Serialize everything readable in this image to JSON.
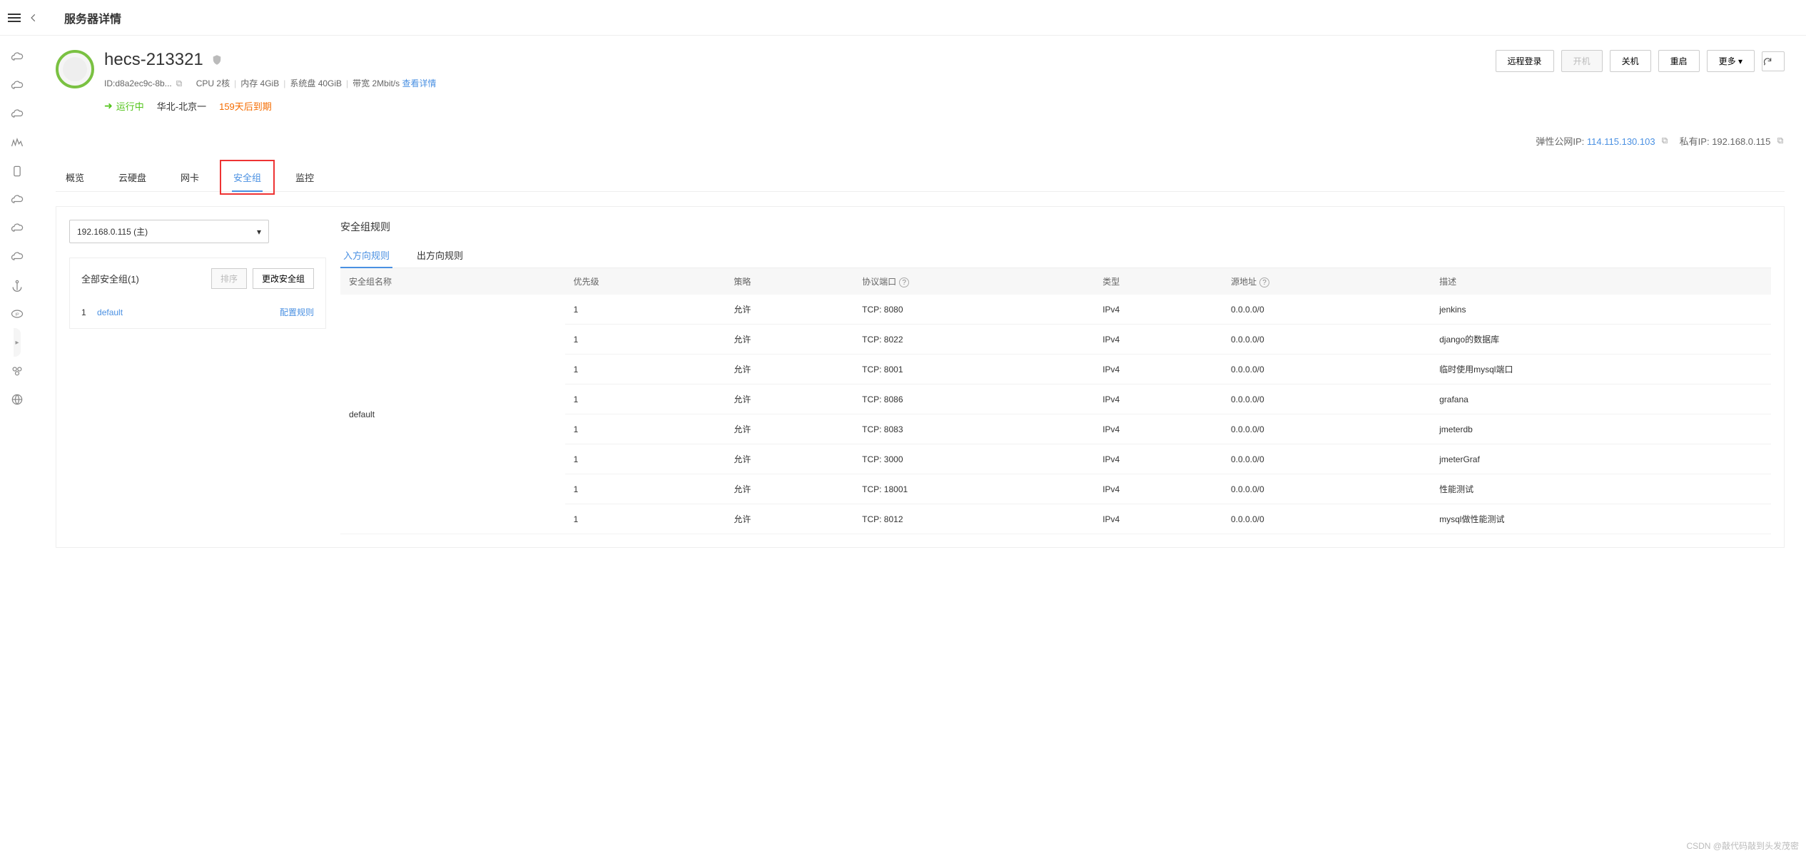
{
  "page": {
    "title": "服务器详情"
  },
  "server": {
    "name": "hecs-213321",
    "id_label": "ID:",
    "id_value": "d8a2ec9c-8b...",
    "spec_cpu": "CPU 2核",
    "spec_mem": "内存 4GiB",
    "spec_disk": "系统盘 40GiB",
    "spec_bw": "带宽 2Mbit/s",
    "spec_link": "查看详情",
    "status": "运行中",
    "region": "华北-北京一",
    "expire": "159天后到期",
    "eip_label": "弹性公网IP:",
    "eip_value": "114.115.130.103",
    "pip_label": "私有IP:",
    "pip_value": "192.168.0.115"
  },
  "actions": {
    "remote_login": "远程登录",
    "power_on": "开机",
    "power_off": "关机",
    "restart": "重启",
    "more": "更多"
  },
  "tabs": {
    "overview": "概览",
    "disk": "云硬盘",
    "nic": "网卡",
    "security_group": "安全组",
    "monitoring": "监控"
  },
  "sg_left": {
    "nic_select_value": "192.168.0.115 (主)",
    "all_sg_label": "全部安全组(1)",
    "sort_btn": "排序",
    "change_btn": "更改安全组",
    "items": [
      {
        "idx": "1",
        "name": "default",
        "config": "配置规则"
      }
    ]
  },
  "rules": {
    "title": "安全组规则",
    "sub_tabs": {
      "inbound": "入方向规则",
      "outbound": "出方向规则"
    },
    "columns": {
      "sg_name": "安全组名称",
      "priority": "优先级",
      "policy": "策略",
      "protocol_port": "协议端口",
      "type": "类型",
      "source": "源地址",
      "description": "描述"
    },
    "group_name": "default",
    "rows": [
      {
        "priority": "1",
        "policy": "允许",
        "protocol": "TCP: 8080",
        "type": "IPv4",
        "source": "0.0.0.0/0",
        "desc": "jenkins"
      },
      {
        "priority": "1",
        "policy": "允许",
        "protocol": "TCP: 8022",
        "type": "IPv4",
        "source": "0.0.0.0/0",
        "desc": "django的数据库"
      },
      {
        "priority": "1",
        "policy": "允许",
        "protocol": "TCP: 8001",
        "type": "IPv4",
        "source": "0.0.0.0/0",
        "desc": "临时使用mysql端口"
      },
      {
        "priority": "1",
        "policy": "允许",
        "protocol": "TCP: 8086",
        "type": "IPv4",
        "source": "0.0.0.0/0",
        "desc": "grafana"
      },
      {
        "priority": "1",
        "policy": "允许",
        "protocol": "TCP: 8083",
        "type": "IPv4",
        "source": "0.0.0.0/0",
        "desc": "jmeterdb"
      },
      {
        "priority": "1",
        "policy": "允许",
        "protocol": "TCP: 3000",
        "type": "IPv4",
        "source": "0.0.0.0/0",
        "desc": "jmeterGraf"
      },
      {
        "priority": "1",
        "policy": "允许",
        "protocol": "TCP: 18001",
        "type": "IPv4",
        "source": "0.0.0.0/0",
        "desc": "性能测试"
      },
      {
        "priority": "1",
        "policy": "允许",
        "protocol": "TCP: 8012",
        "type": "IPv4",
        "source": "0.0.0.0/0",
        "desc": "mysql做性能测试"
      }
    ]
  },
  "watermark": "CSDN @敲代码敲到头发茂密"
}
